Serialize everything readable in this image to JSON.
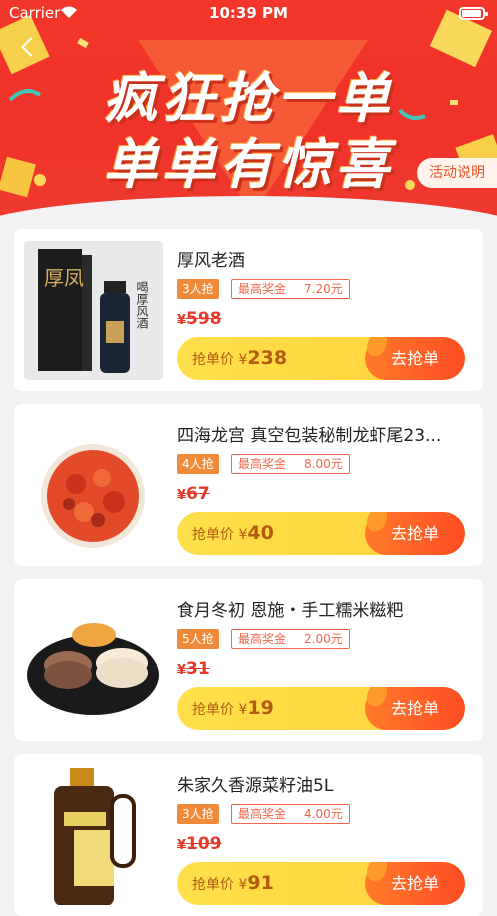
{
  "status": {
    "carrier": "Carrier",
    "time": "10:39 PM"
  },
  "banner": {
    "title_line1": "疯狂抢一单",
    "title_line2": "单单有惊喜",
    "rules_label": "活动说明"
  },
  "products": [
    {
      "name": "厚风老酒",
      "people": "3人抢",
      "prize_label": "最高奖金",
      "prize_amount": "7.20元",
      "currency": "¥",
      "old_price": "598",
      "buy_label": "抢单价",
      "buy_price": "238",
      "buy_btn": "去抢单"
    },
    {
      "name": "四海龙宫 真空包装秘制龙虾尾23...",
      "people": "4人抢",
      "prize_label": "最高奖金",
      "prize_amount": "8.00元",
      "currency": "¥",
      "old_price": "67",
      "buy_label": "抢单价",
      "buy_price": "40",
      "buy_btn": "去抢单"
    },
    {
      "name": "食月冬初 恩施・手工糯米糍粑",
      "people": "5人抢",
      "prize_label": "最高奖金",
      "prize_amount": "2.00元",
      "currency": "¥",
      "old_price": "31",
      "buy_label": "抢单价",
      "buy_price": "19",
      "buy_btn": "去抢单"
    },
    {
      "name": "朱家久香源菜籽油5L",
      "people": "3人抢",
      "prize_label": "最高奖金",
      "prize_amount": "4.00元",
      "currency": "¥",
      "old_price": "109",
      "buy_label": "抢单价",
      "buy_price": "91",
      "buy_btn": "去抢单"
    }
  ],
  "thumb_texts": {
    "wine_logo": "厚凤",
    "wine_slogan": "喝厚风酒"
  },
  "colors": {
    "banner_red": "#f2372a",
    "accent_orange": "#ff5a24",
    "price_red": "#e5392b",
    "buy_yellow": "#ffd23a"
  }
}
